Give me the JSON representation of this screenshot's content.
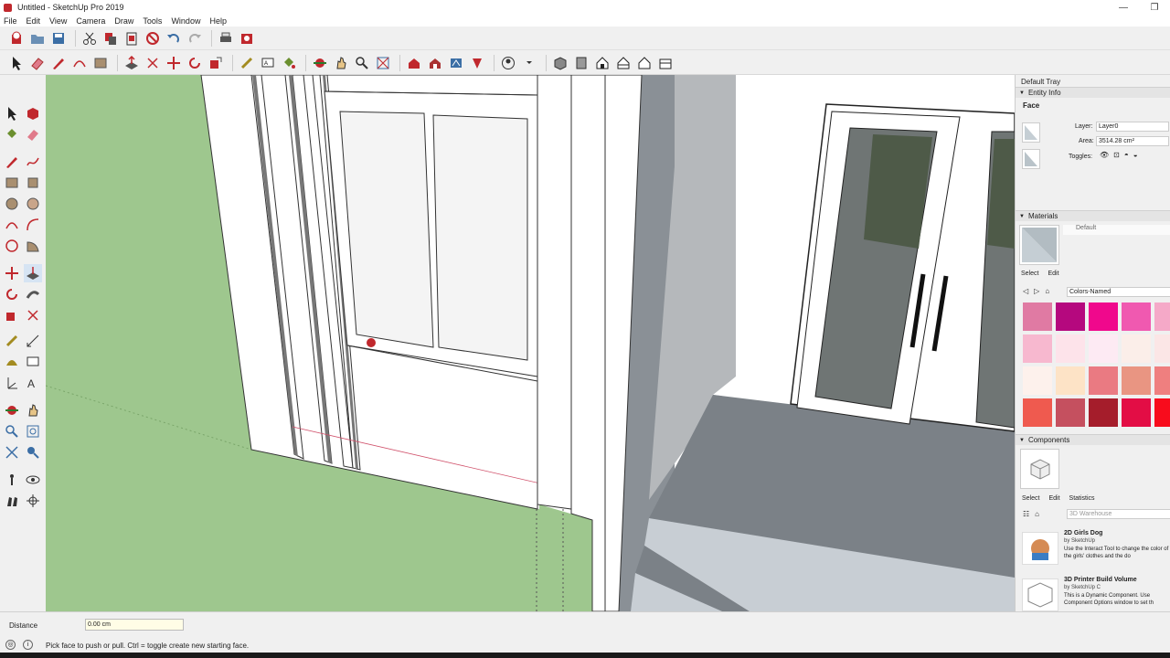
{
  "window": {
    "title": "Untitled - SketchUp Pro 2019",
    "minimize": "—",
    "maximize": "❐"
  },
  "menu": [
    "File",
    "Edit",
    "View",
    "Camera",
    "Draw",
    "Tools",
    "Window",
    "Help"
  ],
  "tray": {
    "title": "Default Tray",
    "entity_info": {
      "header": "Entity Info",
      "type": "Face",
      "layer_label": "Layer:",
      "layer_value": "Layer0",
      "area_label": "Area:",
      "area_value": "3514.28 cm²",
      "toggles_label": "Toggles:"
    },
    "materials": {
      "header": "Materials",
      "current": "Default",
      "tab_select": "Select",
      "tab_edit": "Edit",
      "collection": "Colors-Named",
      "swatches": [
        "#e07aa3",
        "#b5087e",
        "#f0088c",
        "#f059b0",
        "#f5a9c8",
        "#f7b8cf",
        "#fde3ea",
        "#fdeaf3",
        "#fbeee9",
        "#fbe6e6",
        "#fdf1ec",
        "#fde3c6",
        "#ea7a82",
        "#e99582",
        "#ef7f7f",
        "#ef5a4f",
        "#c5505f",
        "#a51d2b",
        "#e30d45",
        "#f80c1c"
      ]
    },
    "components": {
      "header": "Components",
      "tab_select": "Select",
      "tab_edit": "Edit",
      "tab_statistics": "Statistics",
      "search_placeholder": "3D Warehouse",
      "items": [
        {
          "name": "2D Girls Dog",
          "author": "by SketchUp",
          "desc": "Use the Interact Tool to change the color of the girls' clothes and the do"
        },
        {
          "name": "3D Printer Build Volume",
          "author": "by SketchUp C",
          "desc": "This is a Dynamic Component. Use Component Options window to set th"
        }
      ]
    }
  },
  "status": {
    "vcb_label": "Distance",
    "vcb_value": "0.00 cm",
    "message": "Pick face to push or pull.  Ctrl = toggle create new starting face."
  },
  "colors": {
    "ground": "#9ec78e",
    "glass_dark": "#4e5a48",
    "floor_grey": "#7b8187",
    "wall_grey": "#8a9096",
    "accent_red": "#c0282d"
  }
}
